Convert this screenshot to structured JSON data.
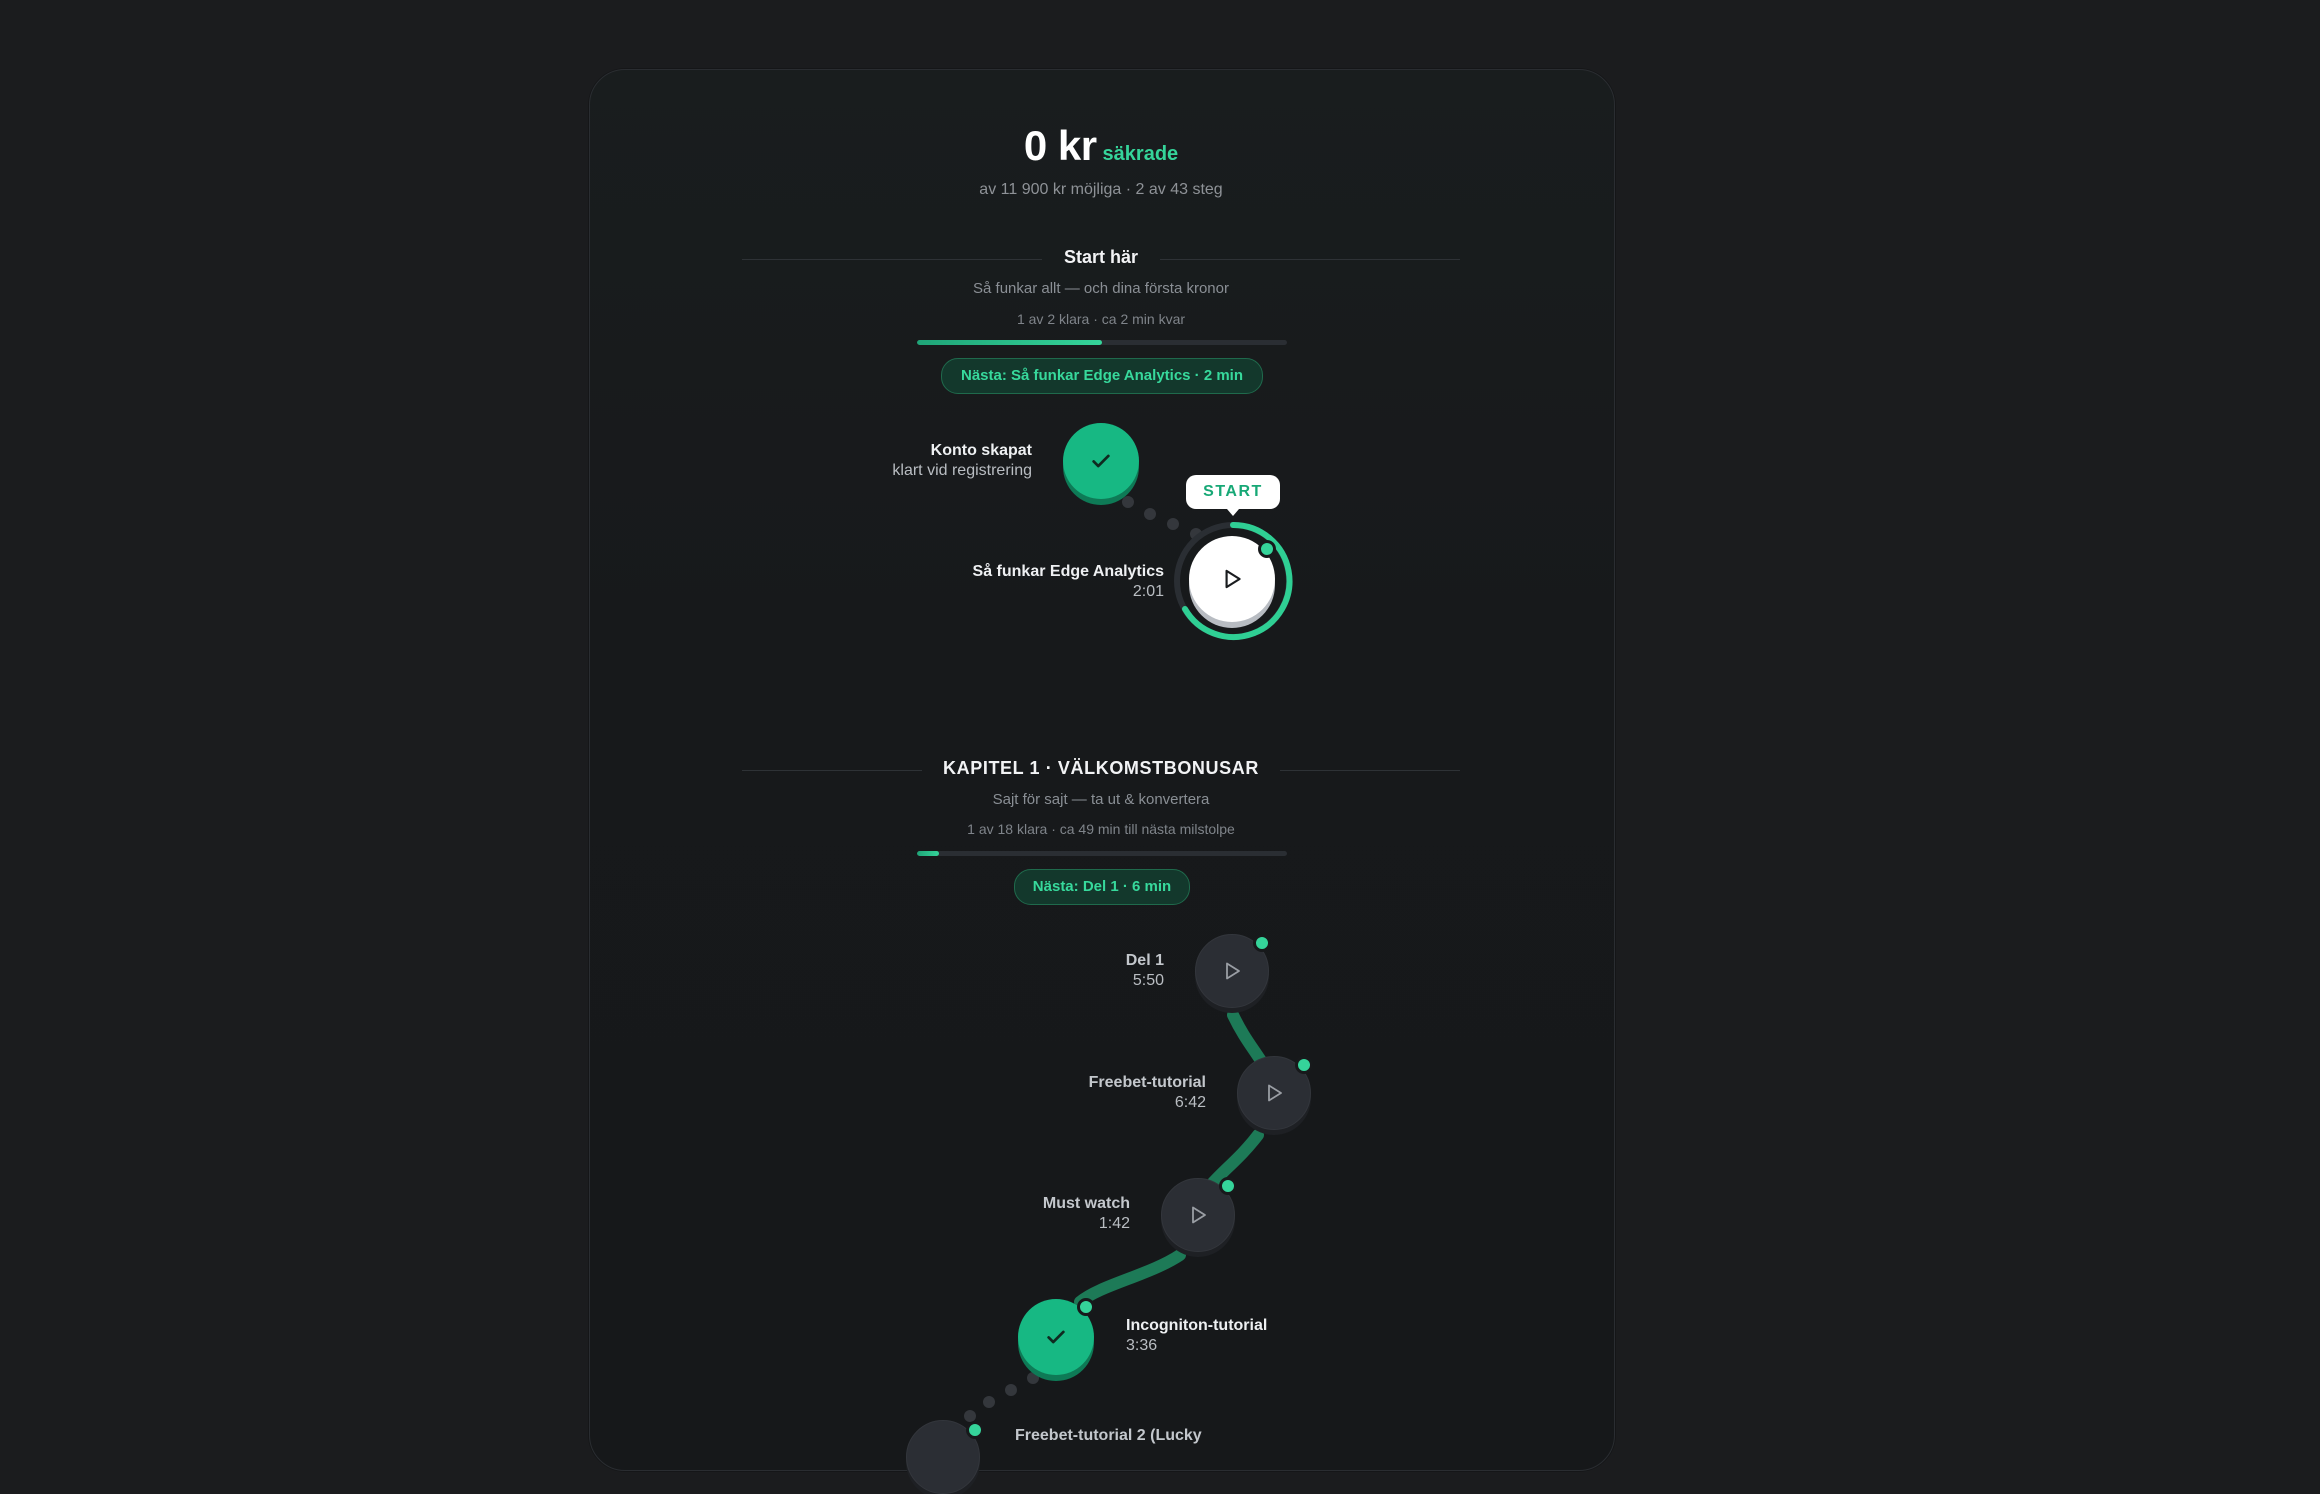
{
  "summary": {
    "amount": "0 kr",
    "amount_suffix": "säkrade",
    "subtitle": "av 11 900 kr möjliga · 2 av 43 steg"
  },
  "sections": [
    {
      "title": "Start här",
      "subtitle": "Så funkar allt — och dina första kronor",
      "meta": "1 av 2 klara · ca 2 min kvar",
      "progress": 0.5,
      "next_pill": "Nästa: Så funkar Edge Analytics · 2 min",
      "steps": [
        {
          "title": "Konto skapat",
          "detail": "klart vid registrering",
          "state": "done",
          "icon": "check-icon"
        },
        {
          "title": "Så funkar Edge Analytics",
          "detail": "2:01",
          "state": "active",
          "icon": "play-icon",
          "tooltip": "START"
        }
      ]
    },
    {
      "title": "KAPITEL 1 · VÄLKOMSTBONUSAR",
      "subtitle": "Sajt för sajt — ta ut & konvertera",
      "meta": "1 av 18 klara · ca 49 min till nästa milstolpe",
      "progress": 0.06,
      "next_pill": "Nästa: Del 1 · 6 min",
      "steps": [
        {
          "title": "Del 1",
          "detail": "5:50",
          "state": "todo",
          "icon": "play-icon"
        },
        {
          "title": "Freebet-tutorial",
          "detail": "6:42",
          "state": "todo",
          "icon": "play-icon"
        },
        {
          "title": "Must watch",
          "detail": "1:42",
          "state": "todo",
          "icon": "play-icon"
        },
        {
          "title": "Incogniton-tutorial",
          "detail": "3:36",
          "state": "done",
          "icon": "check-icon"
        },
        {
          "title": "Freebet-tutorial 2 (Lucky",
          "detail": "",
          "state": "todo",
          "icon": "play-icon"
        }
      ]
    }
  ],
  "colors": {
    "background": "#1b1c1e",
    "accent": "#35d49a",
    "done_node": "#17b883",
    "todo_node": "#2b2e34",
    "pill_bg": "#13382c"
  }
}
